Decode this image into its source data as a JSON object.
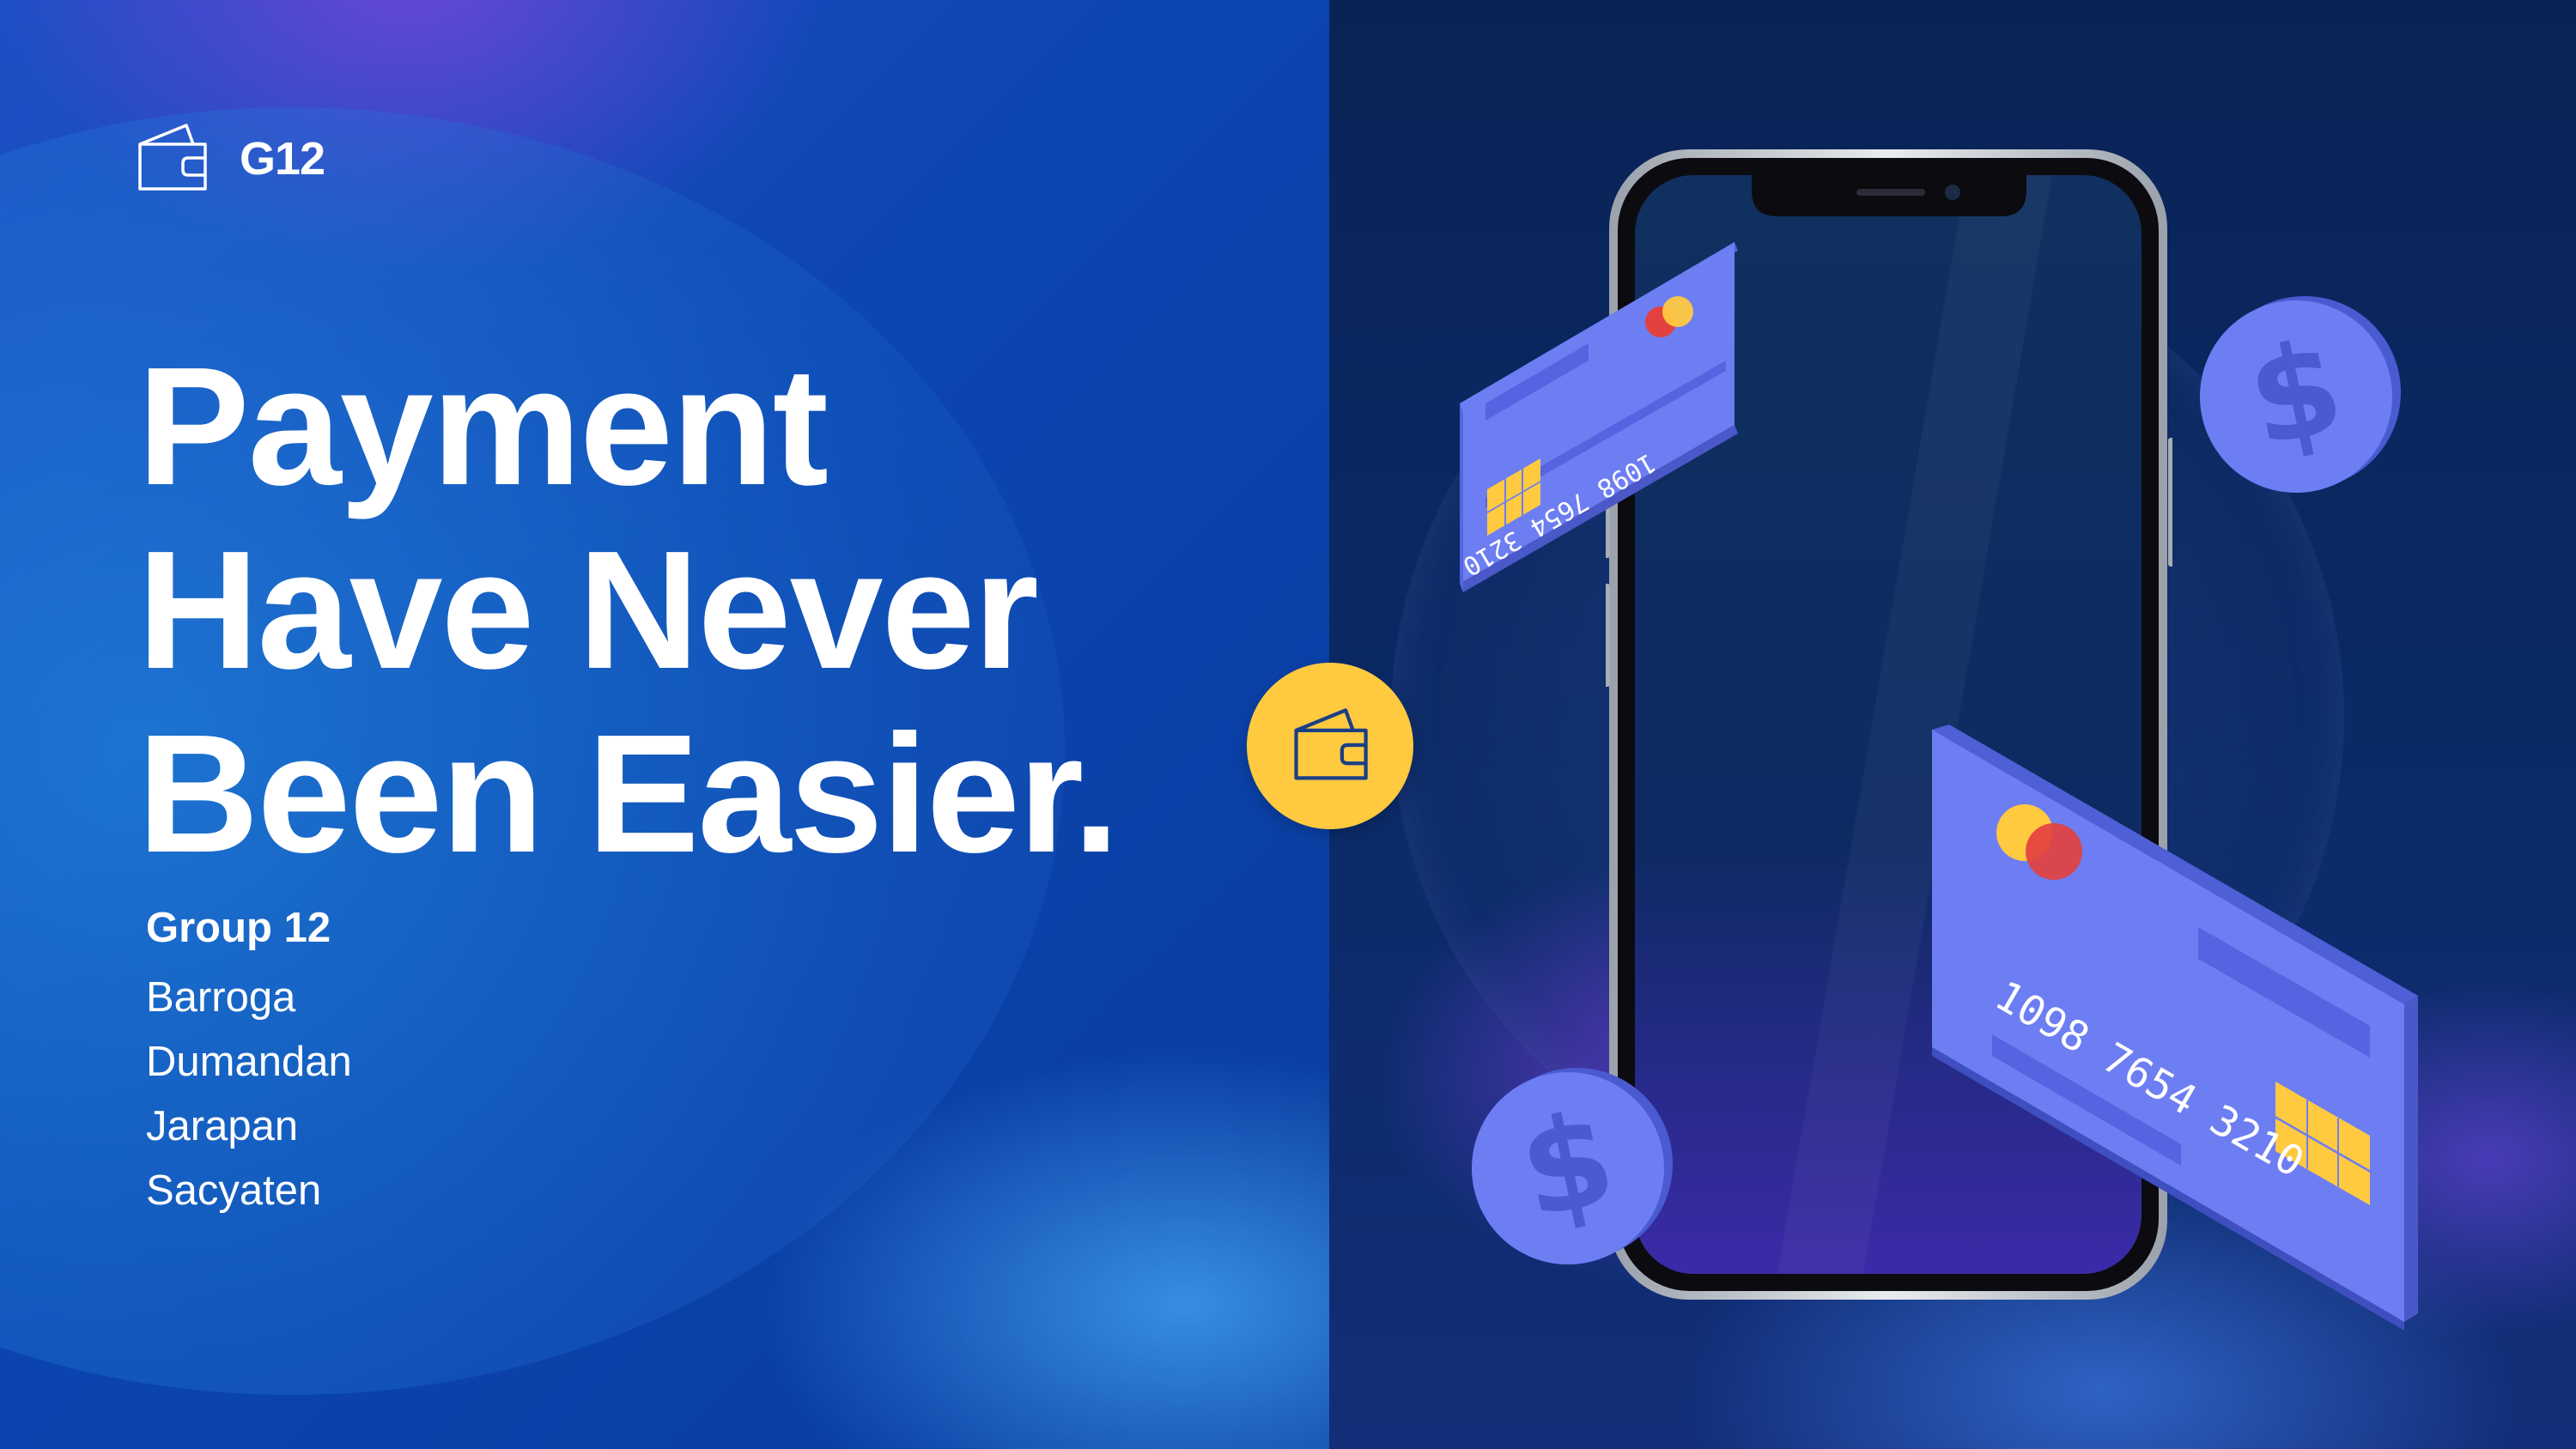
{
  "brand": {
    "icon": "wallet-icon",
    "name": "G12"
  },
  "headline": {
    "line1": "Payment",
    "line2": "Have Never",
    "line3": "Been Easier."
  },
  "group": {
    "title": "Group 12",
    "members": [
      "Barroga",
      "Dumandan",
      "Jarapan",
      "Sacyaten"
    ]
  },
  "illustration": {
    "phone": "smartphone",
    "wallet_badge_icon": "wallet-icon",
    "card_number_top": "1098 7654 3210",
    "card_number_bottom": "1098 7654 3210",
    "coin_icon": "dollar-coin-icon"
  },
  "colors": {
    "left_bg": "#0b45b0",
    "right_bg": "#0a2a66",
    "accent_yellow": "#ffc940",
    "card_blue": "#6d7ef2",
    "text": "#ffffff"
  }
}
